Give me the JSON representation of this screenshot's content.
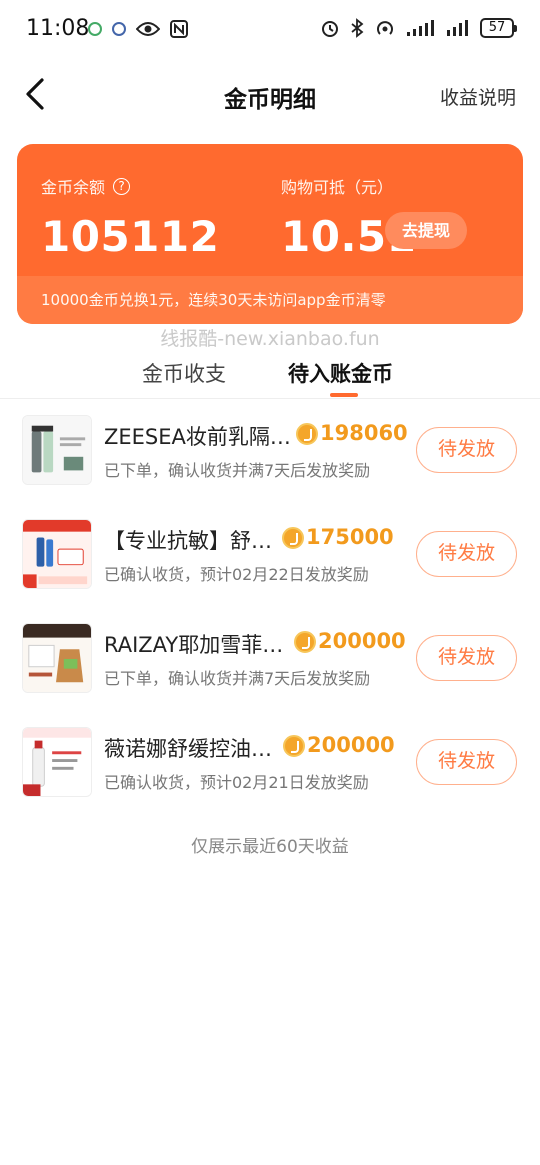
{
  "status_bar": {
    "time": "11:08",
    "battery": "57"
  },
  "header": {
    "title": "金币明细",
    "right_link": "收益说明"
  },
  "balance": {
    "coins_label": "金币余额",
    "coins_value": "105112",
    "shopping_label": "购物可抵（元）",
    "shopping_value": "10.51",
    "withdraw_label": "去提现",
    "note": "10000金币兑换1元，连续30天未访问app金币清零",
    "accent_color": "#ff6a2f"
  },
  "watermark": "线报酷-new.xianbao.fun",
  "tabs": [
    {
      "label": "金币收支",
      "active": false
    },
    {
      "label": "待入账金币",
      "active": true
    }
  ],
  "items": [
    {
      "title": "ZEESEA妆前乳隔…",
      "coins": "198060",
      "status": "已下单，确认收货并满7天后发放奖励",
      "button": "待发放",
      "thumb_icon": "cosmetics-bottles-icon"
    },
    {
      "title": "【专业抗敏】舒…",
      "coins": "175000",
      "status": "已确认收货，预计02月22日发放奖励",
      "button": "待发放",
      "thumb_icon": "toothpaste-icon"
    },
    {
      "title": "RAIZAY耶加雪菲…",
      "coins": "200000",
      "status": "已下单，确认收货并满7天后发放奖励",
      "button": "待发放",
      "thumb_icon": "coffee-bag-icon"
    },
    {
      "title": "薇诺娜舒缓控油…",
      "coins": "200000",
      "status": "已确认收货，预计02月21日发放奖励",
      "button": "待发放",
      "thumb_icon": "skincare-bottle-icon"
    }
  ],
  "footnote": "仅展示最近60天收益"
}
